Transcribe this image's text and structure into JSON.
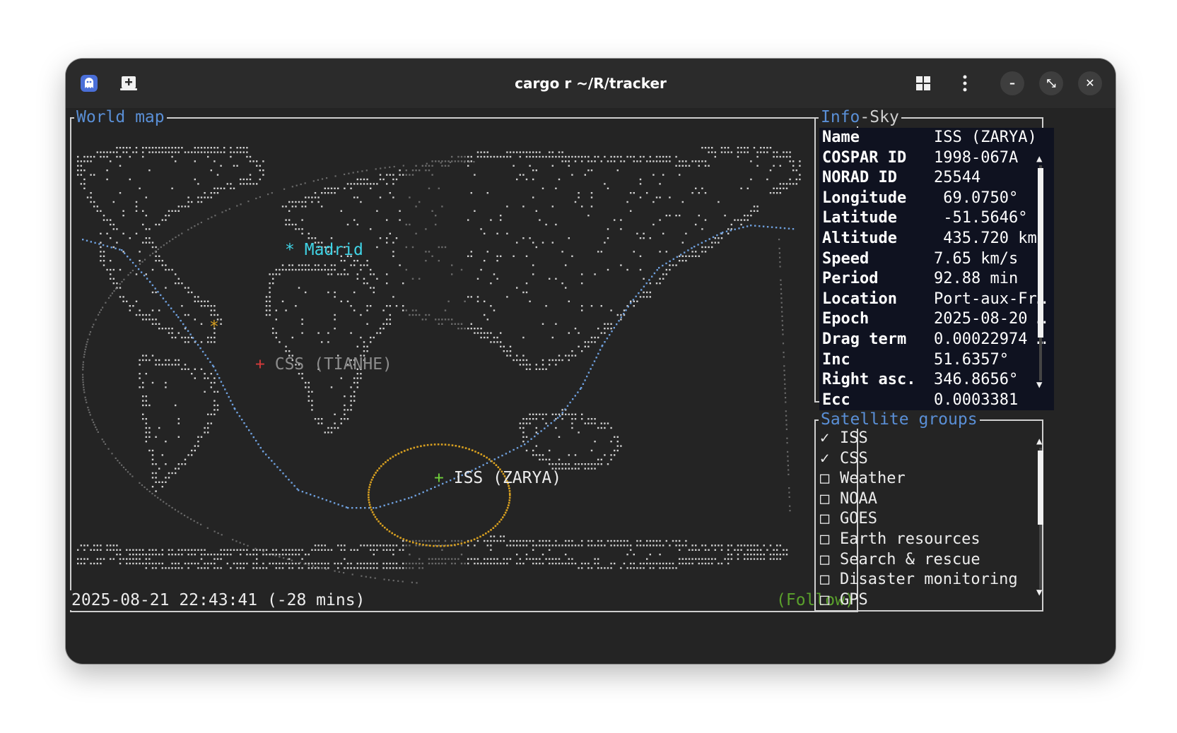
{
  "window": {
    "title": "cargo r ~/R/tracker",
    "icons": [
      "ghost-app-icon",
      "new-tab-icon",
      "grid-icon",
      "kebab-menu-icon",
      "minimize-icon",
      "restore-icon",
      "close-icon"
    ],
    "min_glyph": "–",
    "restore_glyph": "⤡",
    "close_glyph": "✕"
  },
  "world_map": {
    "label": "World map",
    "markers": [
      {
        "symbol": "*",
        "name": "Madrid",
        "color": "#40d4e6"
      },
      {
        "symbol": "+",
        "name": "CSS (TIANHE)",
        "color": "#d33a3a",
        "name_color": "#8c8c8c"
      },
      {
        "symbol": "+",
        "name": "ISS (ZARYA)",
        "color": "#6fcf3a",
        "name_color": "#ececec"
      }
    ],
    "sun_symbol": "*",
    "timestamp": "2025-08-21 22:43:41 (-28 mins)",
    "follow": "(Follow)",
    "colors": {
      "land": "#cfcfcf",
      "night": "#6a6a6a",
      "orbit": "#6e9fdc",
      "footprint": "#d8a020",
      "sun": "#d8a020"
    }
  },
  "info_panel": {
    "tab_active": "Info",
    "separator": "-",
    "tab_inactive": "Sky",
    "rows": [
      {
        "key": "Name",
        "value": "ISS (ZARYA)"
      },
      {
        "key": "COSPAR ID",
        "value": "1998-067A"
      },
      {
        "key": "NORAD ID",
        "value": "25544"
      },
      {
        "key": "Longitude",
        "value": " 69.0750°"
      },
      {
        "key": "Latitude",
        "value": " -51.5646°"
      },
      {
        "key": "Altitude",
        "value": " 435.720 km"
      },
      {
        "key": "Speed",
        "value": "7.65 km/s"
      },
      {
        "key": "Period",
        "value": "92.88 min"
      },
      {
        "key": "Location",
        "value": "Port-aux-Fr…"
      },
      {
        "key": "Epoch",
        "value": "2025-08-20 …"
      },
      {
        "key": "Drag term",
        "value": "0.00022974 …"
      },
      {
        "key": "Inc",
        "value": "51.6357°"
      },
      {
        "key": "Right asc.",
        "value": "346.8656°"
      },
      {
        "key": "Ecc",
        "value": "0.0003381"
      }
    ],
    "scroll_up": "▲",
    "scroll_down": "▼"
  },
  "satellite_groups": {
    "label": "Satellite groups",
    "items": [
      {
        "mark": "✓",
        "name": "ISS"
      },
      {
        "mark": "✓",
        "name": "CSS"
      },
      {
        "mark": "□",
        "name": "Weather"
      },
      {
        "mark": "□",
        "name": "NOAA"
      },
      {
        "mark": "□",
        "name": "GOES"
      },
      {
        "mark": "□",
        "name": "Earth resources"
      },
      {
        "mark": "□",
        "name": "Search & rescue"
      },
      {
        "mark": "□",
        "name": "Disaster monitoring"
      },
      {
        "mark": "□",
        "name": "GPS"
      }
    ],
    "scroll_up": "▲",
    "scroll_down": "▼"
  }
}
